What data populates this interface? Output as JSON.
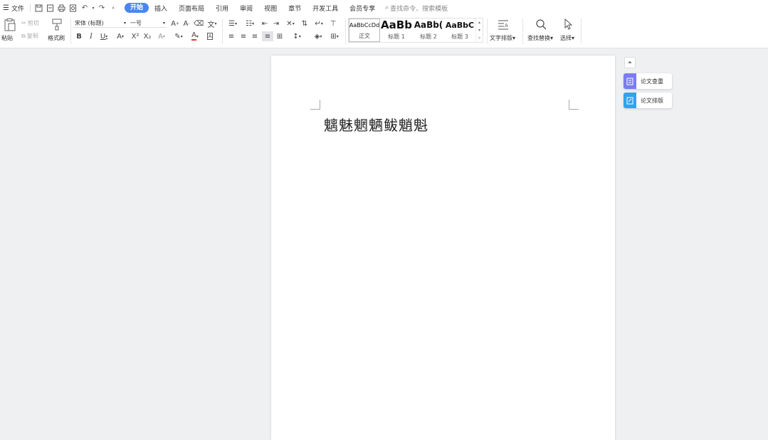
{
  "menubar": {
    "file_label": "文件",
    "tabs": [
      {
        "label": "开始"
      },
      {
        "label": "插入"
      },
      {
        "label": "页面布局"
      },
      {
        "label": "引用"
      },
      {
        "label": "审阅"
      },
      {
        "label": "视图"
      },
      {
        "label": "章节"
      },
      {
        "label": "开发工具"
      },
      {
        "label": "会员专享"
      }
    ],
    "search_label": "查找命令、搜索模板"
  },
  "ribbon": {
    "paste_label": "粘贴",
    "cut_label": "剪切",
    "copy_label": "复制",
    "format_painter_label": "格式刷",
    "font_name": "宋体 (标题)",
    "font_size": "一号",
    "styles": [
      {
        "sample": "AaBbCcDd",
        "name": "正文"
      },
      {
        "sample": "AaBb",
        "name": "标题 1"
      },
      {
        "sample": "AaBb(",
        "name": "标题 2"
      },
      {
        "sample": "AaBbC",
        "name": "标题 3"
      }
    ],
    "text_layout_label": "文字排版",
    "find_replace_label": "查找替换",
    "select_label": "选择"
  },
  "document": {
    "text": "魑魅魍魉鲅魈魁"
  },
  "side_panel": {
    "check_label": "论文查重",
    "layout_label": "论文排版"
  },
  "colors": {
    "accent": "#4a86f0",
    "check_icon": "#7b7cf4",
    "layout_icon": "#2fa3f0"
  }
}
